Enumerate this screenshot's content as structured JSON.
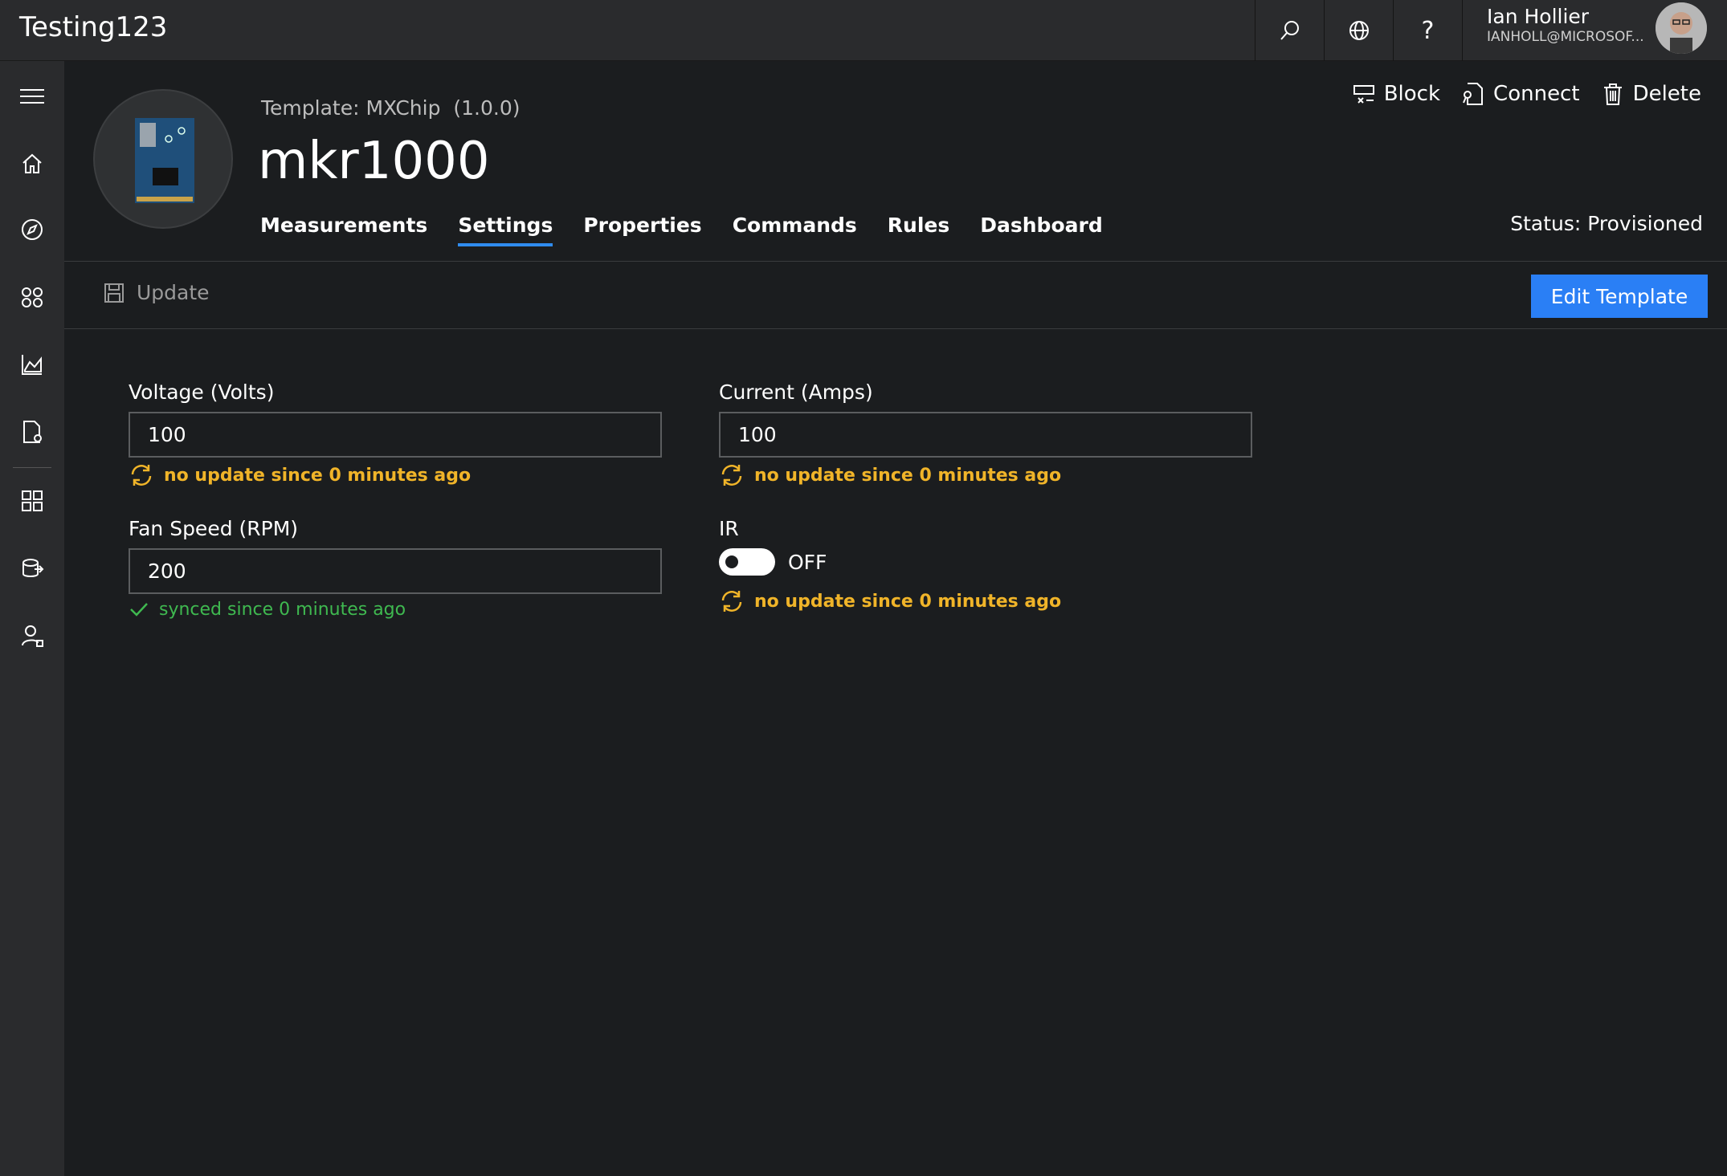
{
  "app": {
    "title": "Testing123"
  },
  "user": {
    "name": "Ian Hollier",
    "email": "IANHOLL@MICROSOF..."
  },
  "topbar_icons": [
    "search-icon",
    "globe-icon",
    "help-icon"
  ],
  "leftnav": [
    "hamburger-icon",
    "home-icon",
    "explorer-icon",
    "device-sets-icon",
    "analytics-icon",
    "jobs-icon",
    "templates-icon",
    "device-explorer-icon",
    "users-icon"
  ],
  "device": {
    "template_label": "Template:",
    "template_name": "MXChip",
    "template_version": "(1.0.0)",
    "name": "mkr1000",
    "status": "Status: Provisioned"
  },
  "actions": {
    "block": "Block",
    "connect": "Connect",
    "delete": "Delete"
  },
  "tabs": [
    {
      "label": "Measurements"
    },
    {
      "label": "Settings"
    },
    {
      "label": "Properties"
    },
    {
      "label": "Commands"
    },
    {
      "label": "Rules"
    },
    {
      "label": "Dashboard"
    }
  ],
  "toolbar": {
    "update": "Update",
    "edit_template": "Edit Template"
  },
  "settings": {
    "voltage": {
      "label": "Voltage (Volts)",
      "value": "100",
      "status": "no update since 0 minutes ago"
    },
    "current": {
      "label": "Current (Amps)",
      "value": "100",
      "status": "no update since 0 minutes ago"
    },
    "fan": {
      "label": "Fan Speed (RPM)",
      "value": "200",
      "status": "synced since 0 minutes ago"
    },
    "ir": {
      "label": "IR",
      "toggle": "OFF",
      "status": "no update since 0 minutes ago"
    }
  },
  "colors": {
    "accent": "#2a7ff5",
    "warning": "#f0b429",
    "success": "#3fb950",
    "bg": "#1b1d1f",
    "chrome": "#2a2b2d"
  }
}
